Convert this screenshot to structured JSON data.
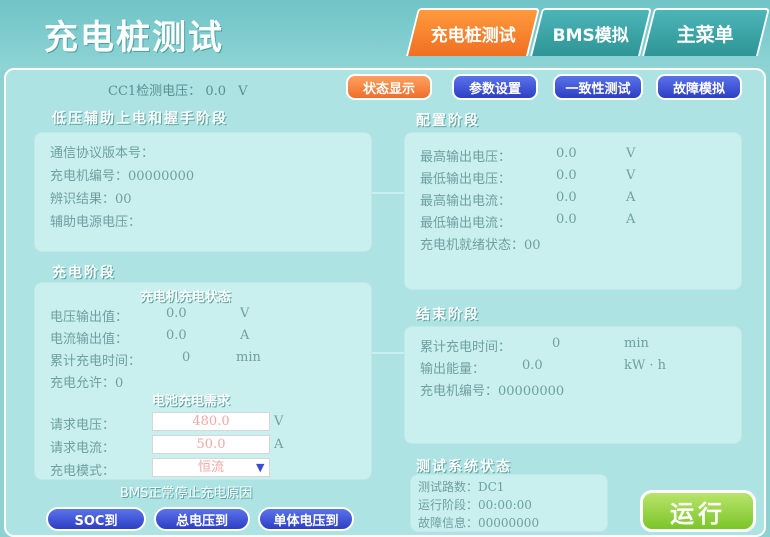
{
  "header": {
    "app_title": "充电桩测试",
    "tabs": [
      {
        "label": "充电桩测试",
        "active": true
      },
      {
        "label": "BMS模拟",
        "active": false
      },
      {
        "label": "主菜单",
        "active": false
      }
    ]
  },
  "toolbar": {
    "cc1_label": "CC1检测电压：",
    "cc1_value": "0.0",
    "cc1_unit": "V",
    "buttons": [
      "状态显示",
      "参数设置",
      "一致性测试",
      "故障模拟"
    ]
  },
  "low_voltage": {
    "title": "低压辅助上电和握手阶段",
    "lines": [
      "通信协议版本号：",
      "充电机编号：00000000",
      "辨识结果：00",
      "辅助电源电压："
    ]
  },
  "config": {
    "title": "配置阶段",
    "rows": [
      {
        "label": "最高输出电压：",
        "value": "0.0",
        "unit": "V"
      },
      {
        "label": "最低输出电压：",
        "value": "0.0",
        "unit": "V"
      },
      {
        "label": "最高输出电流：",
        "value": "0.0",
        "unit": "A"
      },
      {
        "label": "最低输出电流：",
        "value": "0.0",
        "unit": "A"
      }
    ],
    "ready": "充电机就绪状态：00"
  },
  "charging": {
    "title": "充电阶段",
    "charger_status_title": "充电机充电状态",
    "rows": [
      {
        "label": "电压输出值：",
        "value": "0.0",
        "unit": "V"
      },
      {
        "label": "电流输出值：",
        "value": "0.0",
        "unit": "A"
      },
      {
        "label": "累计充电时间：",
        "value": "0",
        "unit": "min"
      }
    ],
    "allow": "充电允许：0",
    "demand_title": "电池充电需求",
    "req_voltage_label": "请求电压：",
    "req_voltage_value": "480.0",
    "req_voltage_unit": "V",
    "req_current_label": "请求电流：",
    "req_current_value": "50.0",
    "req_current_unit": "A",
    "mode_label": "充电模式：",
    "mode_value": "恒流",
    "stop_reason": "BMS正常停止充电原因"
  },
  "end": {
    "title": "结束阶段",
    "rows": [
      {
        "label": "累计充电时间：",
        "value": "0",
        "unit": "min"
      },
      {
        "label": "输出能量：",
        "value": "0.0",
        "unit": "kW · h"
      }
    ],
    "charger_no": "充电机编号：00000000"
  },
  "test_status": {
    "title": "测试系统状态",
    "lines": [
      "测试路数：DC1",
      "运行阶段：00:00:00",
      "故障信息：00000000"
    ]
  },
  "bottom_buttons": [
    "SOC到",
    "总电压到",
    "单体电压到"
  ],
  "run_label": "运行",
  "colors": {
    "accent_orange": "#f06f22",
    "button_blue": "#2d3fc2",
    "run_green": "#7cc52a",
    "panel_bg": "#aee3e3"
  }
}
